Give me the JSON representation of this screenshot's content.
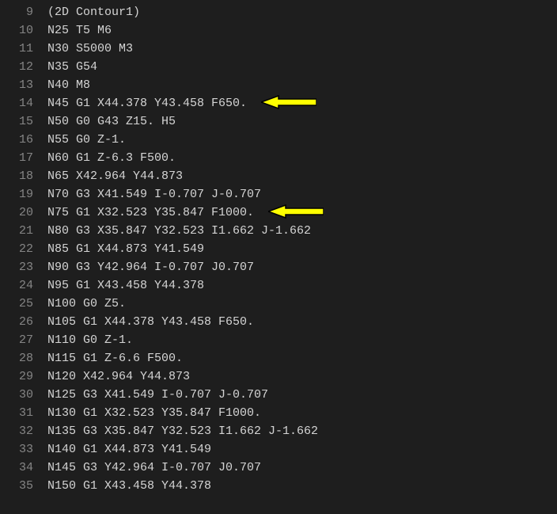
{
  "lines": [
    {
      "num": "9",
      "text": "(2D Contour1)",
      "arrow": false
    },
    {
      "num": "10",
      "text": "N25 T5 M6",
      "arrow": false
    },
    {
      "num": "11",
      "text": "N30 S5000 M3",
      "arrow": false
    },
    {
      "num": "12",
      "text": "N35 G54",
      "arrow": false
    },
    {
      "num": "13",
      "text": "N40 M8",
      "arrow": false
    },
    {
      "num": "14",
      "text": "N45 G1 X44.378 Y43.458 F650.",
      "arrow": true
    },
    {
      "num": "15",
      "text": "N50 G0 G43 Z15. H5",
      "arrow": false
    },
    {
      "num": "16",
      "text": "N55 G0 Z-1.",
      "arrow": false
    },
    {
      "num": "17",
      "text": "N60 G1 Z-6.3 F500.",
      "arrow": false
    },
    {
      "num": "18",
      "text": "N65 X42.964 Y44.873",
      "arrow": false
    },
    {
      "num": "19",
      "text": "N70 G3 X41.549 I-0.707 J-0.707",
      "arrow": false
    },
    {
      "num": "20",
      "text": "N75 G1 X32.523 Y35.847 F1000.",
      "arrow": true
    },
    {
      "num": "21",
      "text": "N80 G3 X35.847 Y32.523 I1.662 J-1.662",
      "arrow": false
    },
    {
      "num": "22",
      "text": "N85 G1 X44.873 Y41.549",
      "arrow": false
    },
    {
      "num": "23",
      "text": "N90 G3 Y42.964 I-0.707 J0.707",
      "arrow": false
    },
    {
      "num": "24",
      "text": "N95 G1 X43.458 Y44.378",
      "arrow": false
    },
    {
      "num": "25",
      "text": "N100 G0 Z5.",
      "arrow": false
    },
    {
      "num": "26",
      "text": "N105 G1 X44.378 Y43.458 F650.",
      "arrow": false
    },
    {
      "num": "27",
      "text": "N110 G0 Z-1.",
      "arrow": false
    },
    {
      "num": "28",
      "text": "N115 G1 Z-6.6 F500.",
      "arrow": false
    },
    {
      "num": "29",
      "text": "N120 X42.964 Y44.873",
      "arrow": false
    },
    {
      "num": "30",
      "text": "N125 G3 X41.549 I-0.707 J-0.707",
      "arrow": false
    },
    {
      "num": "31",
      "text": "N130 G1 X32.523 Y35.847 F1000.",
      "arrow": false
    },
    {
      "num": "32",
      "text": "N135 G3 X35.847 Y32.523 I1.662 J-1.662",
      "arrow": false
    },
    {
      "num": "33",
      "text": "N140 G1 X44.873 Y41.549",
      "arrow": false
    },
    {
      "num": "34",
      "text": "N145 G3 Y42.964 I-0.707 J0.707",
      "arrow": false
    },
    {
      "num": "35",
      "text": "N150 G1 X43.458 Y44.378",
      "arrow": false
    }
  ],
  "colors": {
    "arrow_fill": "#ffff00",
    "arrow_stroke": "#000000"
  }
}
